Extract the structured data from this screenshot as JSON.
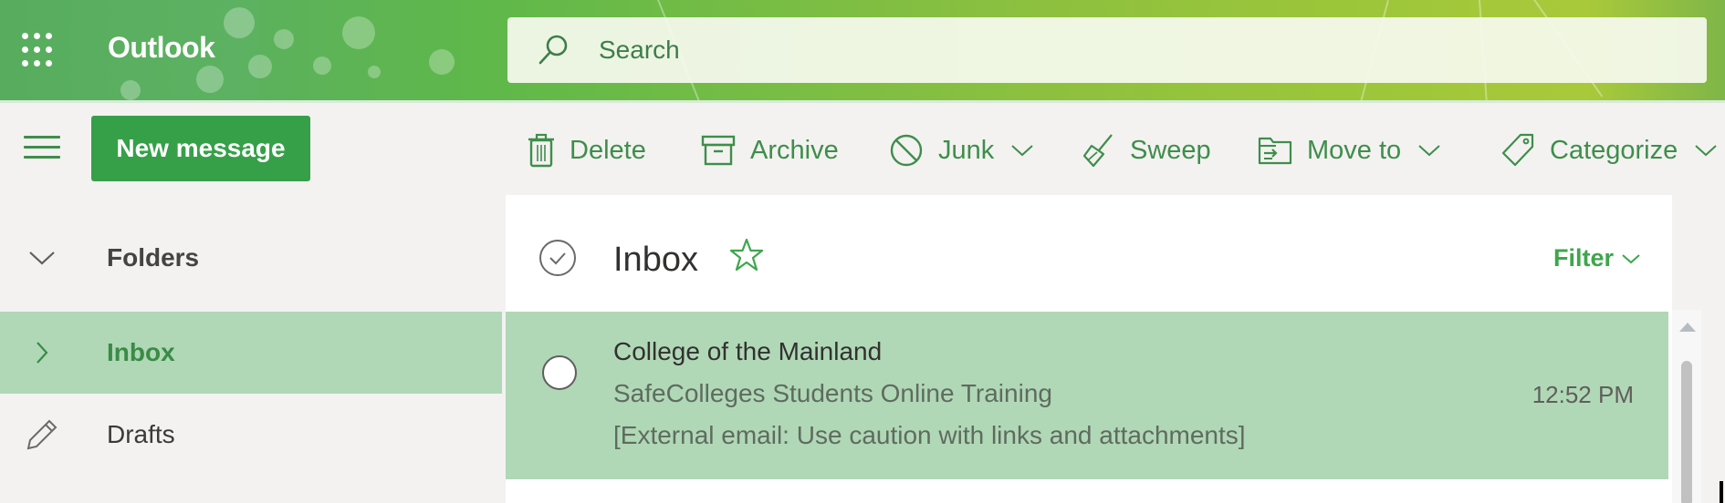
{
  "header": {
    "app_title": "Outlook",
    "app_launcher_icon": "waffle-grid-icon",
    "search": {
      "placeholder": "Search",
      "value": "",
      "icon": "search-icon"
    }
  },
  "commandbar": {
    "menu_icon": "hamburger-icon",
    "new_message_label": "New message",
    "actions": [
      {
        "label": "Delete",
        "icon": "trash-icon",
        "has_dropdown": false
      },
      {
        "label": "Archive",
        "icon": "archive-box-icon",
        "has_dropdown": false
      },
      {
        "label": "Junk",
        "icon": "block-icon",
        "has_dropdown": true
      },
      {
        "label": "Sweep",
        "icon": "broom-icon",
        "has_dropdown": false
      },
      {
        "label": "Move to",
        "icon": "folder-move-icon",
        "has_dropdown": true
      },
      {
        "label": "Categorize",
        "icon": "tag-icon",
        "has_dropdown": true
      }
    ]
  },
  "leftnav": {
    "folders_label": "Folders",
    "items": [
      {
        "label": "Inbox",
        "icon": "chevron-right-icon",
        "selected": true
      },
      {
        "label": "Drafts",
        "icon": "pencil-icon",
        "selected": false
      }
    ]
  },
  "message_list": {
    "title": "Inbox",
    "filter_label": "Filter",
    "messages": [
      {
        "sender": "College of the Mainland",
        "subject": "SafeColleges Students Online Training",
        "preview": "[External email: Use caution with links and attachments]",
        "time": "12:52 PM",
        "selected": true
      }
    ]
  },
  "colors": {
    "brand_green": "#36a048",
    "accent_text_green": "#3e8e4a",
    "selected_bg": "#b0d8b6",
    "pane_bg": "#f3f2f1"
  }
}
